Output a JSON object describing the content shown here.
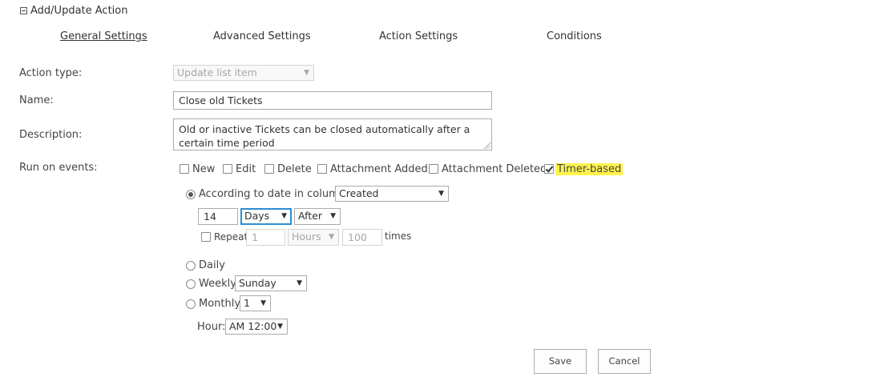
{
  "section": {
    "title": "Add/Update Action"
  },
  "tabs": [
    {
      "label": "General Settings",
      "active": true
    },
    {
      "label": "Advanced Settings"
    },
    {
      "label": "Action Settings"
    },
    {
      "label": "Conditions"
    }
  ],
  "form": {
    "action_type": {
      "label": "Action type:",
      "value": "Update list item"
    },
    "name": {
      "label": "Name:",
      "value": "Close old Tickets"
    },
    "description": {
      "label": "Description:",
      "value": "Old or inactive Tickets can be closed automatically after a certain time period"
    },
    "run_on_events": {
      "label": "Run on events:",
      "events": [
        {
          "label": "New",
          "checked": false
        },
        {
          "label": "Edit",
          "checked": false
        },
        {
          "label": "Delete",
          "checked": false
        },
        {
          "label": "Attachment Added",
          "checked": false
        },
        {
          "label": "Attachment Deleted",
          "checked": false
        },
        {
          "label": "Timer-based",
          "checked": true
        }
      ]
    },
    "timer": {
      "according_label": "According to date in column:",
      "column_value": "Created",
      "amount_value": "14",
      "unit_value": "Days",
      "direction_value": "After",
      "repeat_label": "Repeat",
      "repeat_value": "1",
      "repeat_unit_value": "Hours",
      "repeat_times_value": "100",
      "times_label": "times",
      "daily_label": "Daily",
      "weekly_label": "Weekly",
      "weekly_value": "Sunday",
      "monthly_label": "Monthly",
      "monthly_value": "1",
      "hour_label": "Hour:",
      "hour_value": "AM 12:00"
    }
  },
  "buttons": {
    "save": "Save",
    "cancel": "Cancel"
  },
  "icons": {
    "dropdown": "chevron-down-icon",
    "collapse": "collapse-minus-icon"
  },
  "colors": {
    "highlight": "#fff34d",
    "focus_border": "#2a8dd4"
  }
}
